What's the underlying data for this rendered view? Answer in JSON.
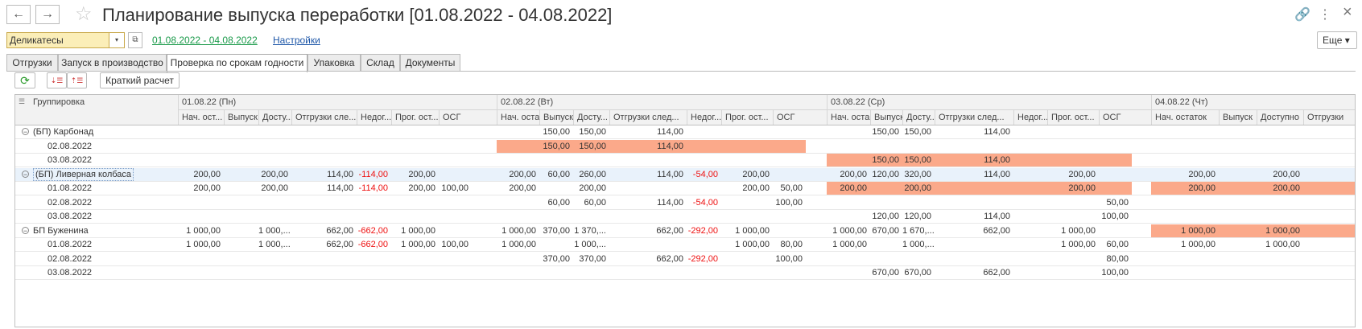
{
  "window": {
    "title": "Планирование выпуска переработки [01.08.2022 - 04.08.2022]",
    "back_icon": "←",
    "forward_icon": "→",
    "star_icon": "☆",
    "link_icon": "🔗",
    "menu_icon": "⋮",
    "close_icon": "×"
  },
  "filter": {
    "category": "Деликатесы",
    "dropdown_icon": "▾",
    "copy_icon": "⧉",
    "period_link": "01.08.2022 - 04.08.2022",
    "settings_link": "Настройки",
    "more_label": "Еще ▾"
  },
  "tabs": [
    {
      "label": "Отгрузки"
    },
    {
      "label": "Запуск в производство"
    },
    {
      "label": "Проверка по срокам годности"
    },
    {
      "label": "Упаковка"
    },
    {
      "label": "Склад"
    },
    {
      "label": "Документы"
    }
  ],
  "toolbar": {
    "refresh_icon": "⟳",
    "sort_icon_1": "⇣☰",
    "sort_icon_2": "⇡☰",
    "calc_label": "Краткий расчет"
  },
  "grid": {
    "group_header": "Группировка",
    "days": [
      "01.08.22 (Пн)",
      "02.08.22 (Вт)",
      "03.08.22 (Ср)",
      "04.08.22 (Чт)"
    ],
    "subcols": [
      [
        "Нач. ост...",
        "Выпуск",
        "Досту...",
        "Отгрузки сле...",
        "Недог...",
        "Прог. ост...",
        "ОСГ"
      ],
      [
        "Нач. оста...",
        "Выпуск",
        "Досту...",
        "Отгрузки след...",
        "Недог...",
        "Прог. ост...",
        "ОСГ"
      ],
      [
        "Нач. оста...",
        "Выпуск",
        "Досту...",
        "Отгрузки след...",
        "Недог...",
        "Прог. ост...",
        "ОСГ"
      ],
      [
        "Нач. остаток",
        "Выпуск",
        "Доступно",
        "Отгрузки"
      ]
    ],
    "rows": [
      {
        "label": "(БП) Карбонад",
        "group": true,
        "cells": {
          "d2_vyp": "150,00",
          "d2_dost": "150,00",
          "d2_otgr": "114,00",
          "d3_vyp": "150,00",
          "d3_dost": "150,00",
          "d3_otgr": "114,00"
        }
      },
      {
        "label": "02.08.2022",
        "cells": {
          "d2_vyp": "150,00",
          "d2_dost": "150,00",
          "d2_otgr": "114,00"
        }
      },
      {
        "label": "03.08.2022",
        "cells": {
          "d3_vyp": "150,00",
          "d3_dost": "150,00",
          "d3_otgr": "114,00"
        }
      },
      {
        "label": "(БП) Ливерная колбаса",
        "group": true,
        "cells": {
          "d1_nach": "200,00",
          "d1_dost": "200,00",
          "d1_otgr": "114,00",
          "d1_nedog": "-114,00",
          "d1_prog": "200,00",
          "d2_nach": "200,00",
          "d2_vyp": "60,00",
          "d2_dost": "260,00",
          "d2_otgr": "114,00",
          "d2_nedog": "-54,00",
          "d2_prog": "200,00",
          "d3_nach": "200,00",
          "d3_vyp": "120,00",
          "d3_dost": "320,00",
          "d3_otgr": "114,00",
          "d3_prog": "200,00",
          "d4_nach": "200,00",
          "d4_dost": "200,00"
        }
      },
      {
        "label": "01.08.2022",
        "cells": {
          "d1_nach": "200,00",
          "d1_dost": "200,00",
          "d1_otgr": "114,00",
          "d1_nedog": "-114,00",
          "d1_prog": "200,00",
          "d1_osg": "100,00",
          "d2_nach": "200,00",
          "d2_dost": "200,00",
          "d2_prog": "200,00",
          "d2_osg": "50,00",
          "d3_nach": "200,00",
          "d3_dost": "200,00",
          "d3_prog": "200,00",
          "d4_nach": "200,00",
          "d4_dost": "200,00"
        }
      },
      {
        "label": "02.08.2022",
        "cells": {
          "d2_vyp": "60,00",
          "d2_dost": "60,00",
          "d2_otgr": "114,00",
          "d2_nedog": "-54,00",
          "d2_osg": "100,00",
          "d3_osg": "50,00"
        }
      },
      {
        "label": "03.08.2022",
        "cells": {
          "d3_vyp": "120,00",
          "d3_dost": "120,00",
          "d3_otgr": "114,00",
          "d3_osg": "100,00"
        }
      },
      {
        "label": "БП Буженина",
        "group": true,
        "cells": {
          "d1_nach": "1 000,00",
          "d1_dost": "1 000,...",
          "d1_otgr": "662,00",
          "d1_nedog": "-662,00",
          "d1_prog": "1 000,00",
          "d2_nach": "1 000,00",
          "d2_vyp": "370,00",
          "d2_dost": "1 370,...",
          "d2_otgr": "662,00",
          "d2_nedog": "-292,00",
          "d2_prog": "1 000,00",
          "d3_nach": "1 000,00",
          "d3_vyp": "670,00",
          "d3_dost": "1 670,...",
          "d3_otgr": "662,00",
          "d3_prog": "1 000,00",
          "d4_nach": "1 000,00",
          "d4_dost": "1 000,00"
        }
      },
      {
        "label": "01.08.2022",
        "cells": {
          "d1_nach": "1 000,00",
          "d1_dost": "1 000,...",
          "d1_otgr": "662,00",
          "d1_nedog": "-662,00",
          "d1_prog": "1 000,00",
          "d1_osg": "100,00",
          "d2_nach": "1 000,00",
          "d2_dost": "1 000,...",
          "d2_prog": "1 000,00",
          "d2_osg": "80,00",
          "d3_nach": "1 000,00",
          "d3_dost": "1 000,...",
          "d3_prog": "1 000,00",
          "d3_osg": "60,00",
          "d4_nach": "1 000,00",
          "d4_dost": "1 000,00"
        }
      },
      {
        "label": "02.08.2022",
        "cells": {
          "d2_vyp": "370,00",
          "d2_dost": "370,00",
          "d2_otgr": "662,00",
          "d2_nedog": "-292,00",
          "d2_osg": "100,00",
          "d3_osg": "80,00"
        }
      },
      {
        "label": "03.08.2022",
        "cells": {
          "d3_vyp": "670,00",
          "d3_dost": "670,00",
          "d3_otgr": "662,00",
          "d3_osg": "100,00"
        }
      }
    ]
  }
}
